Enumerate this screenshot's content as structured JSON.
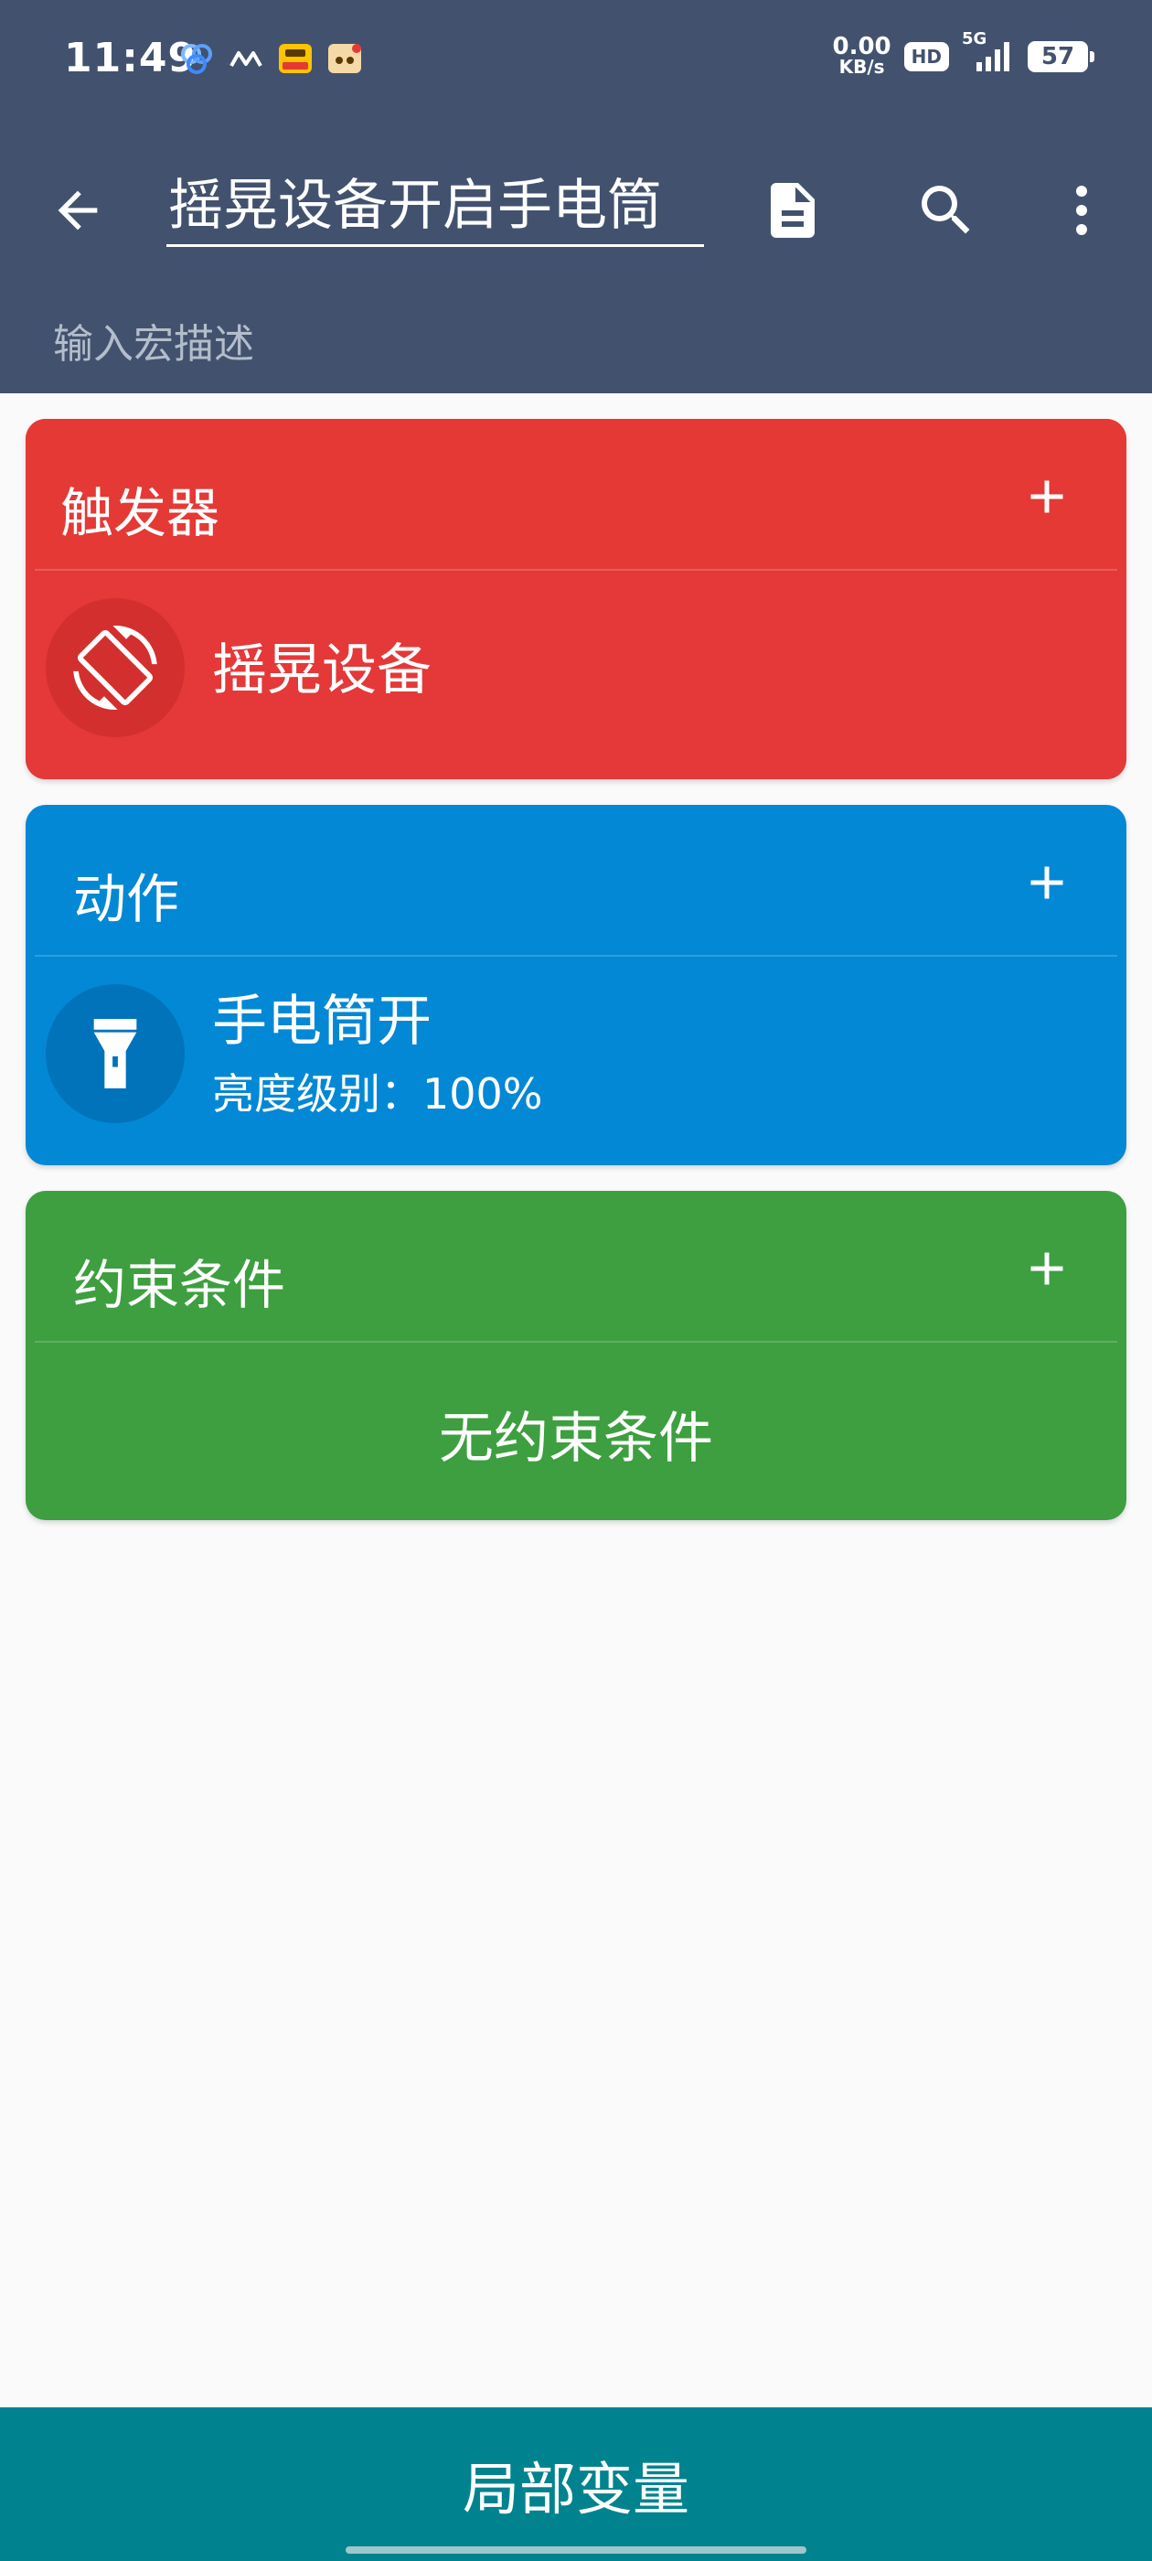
{
  "status_bar": {
    "time": "11:49",
    "net_speed_value": "0.00",
    "net_speed_unit": "KB/s",
    "hd": "HD",
    "network": "5G",
    "battery": "57"
  },
  "toolbar": {
    "title": "摇晃设备开启手电筒",
    "description_placeholder": "输入宏描述"
  },
  "triggers": {
    "title": "触发器",
    "items": [
      {
        "title": "摇晃设备",
        "icon": "screen-rotation-icon"
      }
    ]
  },
  "actions": {
    "title": "动作",
    "items": [
      {
        "title": "手电筒开",
        "subtitle": "亮度级别：100%",
        "icon": "flashlight-icon"
      }
    ]
  },
  "constraints": {
    "title": "约束条件",
    "empty_text": "无约束条件"
  },
  "bottom_bar": {
    "label": "局部变量"
  },
  "colors": {
    "header": "#42526E",
    "trigger": "#E53935",
    "action": "#0388D5",
    "constraint": "#3D9F3F",
    "bottom_bar": "#00838F"
  }
}
